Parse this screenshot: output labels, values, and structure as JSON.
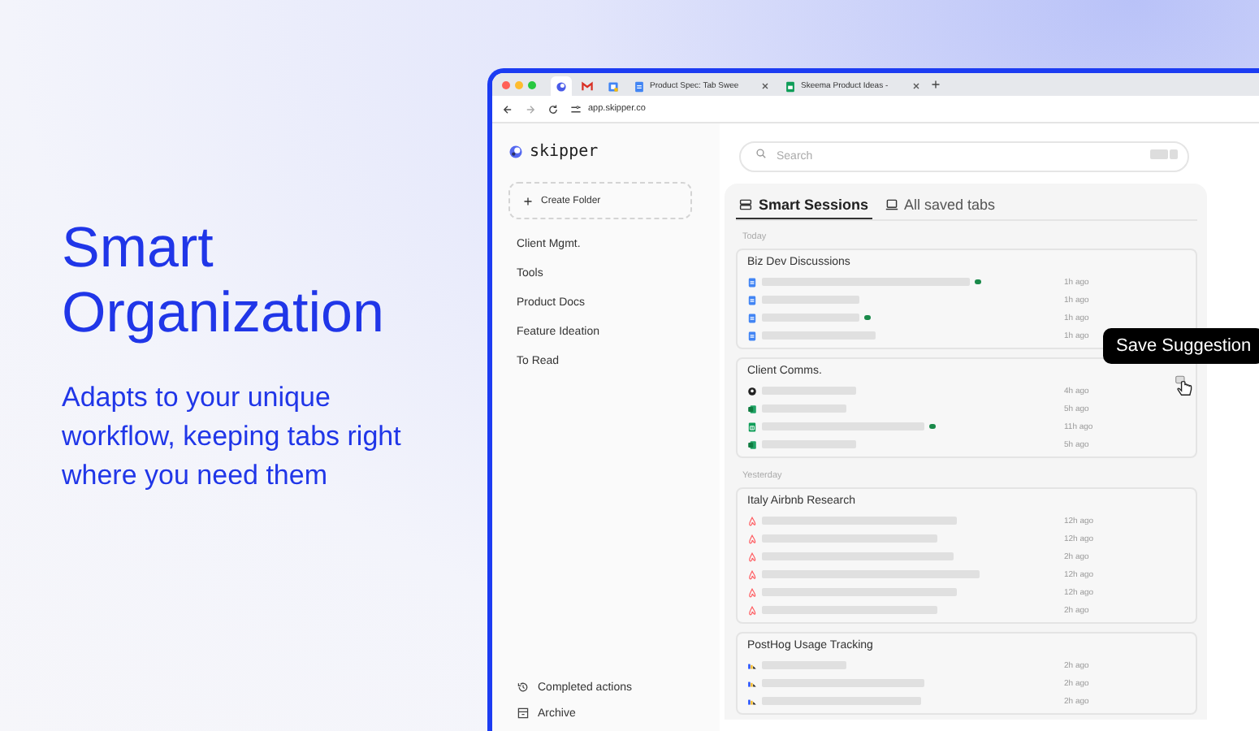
{
  "hero": {
    "title": "Smart Organization",
    "subtitle": "Adapts to your unique workflow, keeping tabs right where you need them"
  },
  "browser": {
    "tabs": [
      {
        "kind": "app",
        "selected": true
      },
      {
        "kind": "mail",
        "selected": false
      },
      {
        "kind": "calendar",
        "selected": false
      },
      {
        "kind": "doc",
        "title": "Product Spec: Tab Swee",
        "selected": false
      },
      {
        "kind": "sheet",
        "title": "Skeema Product Ideas - ",
        "selected": false
      }
    ],
    "url": "app.skipper.co"
  },
  "app": {
    "logo": "skipper",
    "search": {
      "placeholder": "Search"
    },
    "create_folder": "Create Folder",
    "folders": [
      "Client Mgmt.",
      "Tools",
      "Product Docs",
      "Feature Ideation",
      "To Read"
    ],
    "footer": [
      {
        "kind": "history",
        "label": "Completed actions"
      },
      {
        "kind": "archive",
        "label": "Archive"
      }
    ],
    "view_tabs": [
      {
        "kind": "sessions",
        "label": "Smart Sessions",
        "selected": true
      },
      {
        "kind": "tabs",
        "label": "All saved tabs",
        "selected": false
      }
    ],
    "groups": [
      {
        "heading": "Today",
        "sessions": [
          {
            "title": "Biz Dev Discussions",
            "tabs": [
              {
                "kind": "doc",
                "active": true,
                "time": "1h ago"
              },
              {
                "kind": "doc",
                "active": false,
                "time": "1h ago"
              },
              {
                "kind": "doc",
                "active": true,
                "time": "1h ago"
              },
              {
                "kind": "doc",
                "active": false,
                "time": "1h ago"
              }
            ]
          },
          {
            "title": "Client Comms.",
            "tabs": [
              {
                "kind": "github",
                "active": false,
                "time": "4h ago"
              },
              {
                "kind": "excel",
                "active": false,
                "time": "5h ago"
              },
              {
                "kind": "sheets",
                "active": true,
                "time": "11h ago"
              },
              {
                "kind": "excel",
                "active": false,
                "time": "5h ago"
              }
            ]
          }
        ]
      },
      {
        "heading": "Yesterday",
        "sessions": [
          {
            "title": "Italy Airbnb Research",
            "tabs": [
              {
                "kind": "airbnb",
                "active": false,
                "time": "12h ago"
              },
              {
                "kind": "airbnb",
                "active": false,
                "time": "12h ago"
              },
              {
                "kind": "airbnb",
                "active": false,
                "time": "2h ago"
              },
              {
                "kind": "airbnb",
                "active": false,
                "time": "12h ago"
              },
              {
                "kind": "airbnb",
                "active": false,
                "time": "12h ago"
              },
              {
                "kind": "airbnb",
                "active": false,
                "time": "2h ago"
              }
            ]
          },
          {
            "title": "PostHog Usage Tracking",
            "tabs": [
              {
                "kind": "posthog",
                "active": false,
                "time": "2h ago"
              },
              {
                "kind": "posthog",
                "active": false,
                "time": "2h ago"
              },
              {
                "kind": "posthog",
                "active": false,
                "time": "2h ago"
              }
            ]
          }
        ]
      }
    ],
    "tooltip": "Save Suggestion"
  }
}
